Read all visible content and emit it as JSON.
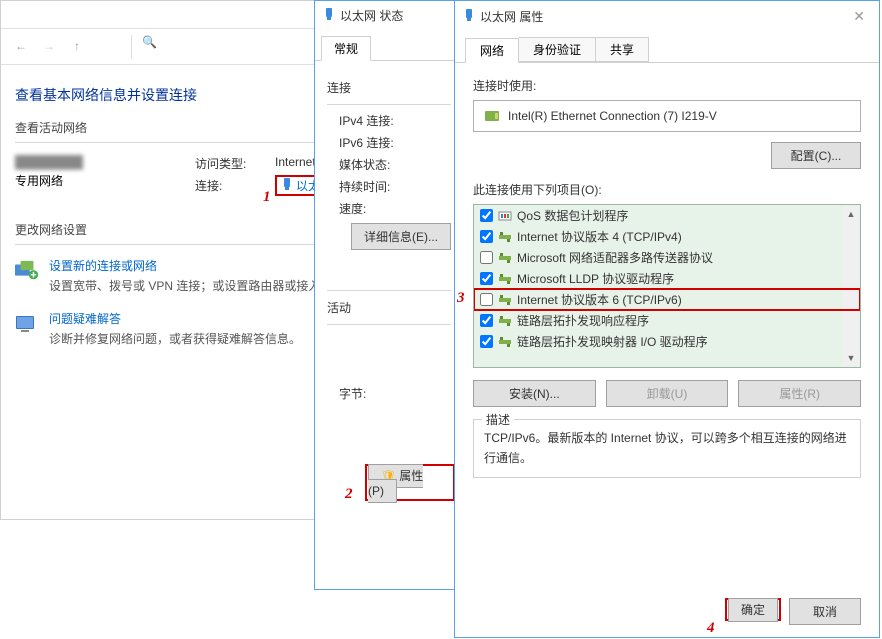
{
  "annotations": {
    "n1": "1",
    "n2": "2",
    "n3": "3",
    "n4": "4"
  },
  "bg": {
    "heading": "查看基本网络信息并设置连接",
    "section_active": "查看活动网络",
    "access_type_label": "访问类型:",
    "access_type_value": "Internet",
    "conn_label": "连接:",
    "conn_value": "以太网",
    "private_net": "专用网络",
    "section_change": "更改网络设置",
    "link_new": "设置新的连接或网络",
    "link_new_desc": "设置宽带、拨号或 VPN 连接；或设置路由器或接入点。",
    "link_trouble": "问题疑难解答",
    "link_trouble_desc": "诊断并修复网络问题，或者获得疑难解答信息。"
  },
  "status": {
    "title": "以太网 状态",
    "tab_general": "常规",
    "section_conn": "连接",
    "ipv4_label": "IPv4 连接:",
    "ipv6_label": "IPv6 连接:",
    "media_label": "媒体状态:",
    "duration_label": "持续时间:",
    "speed_label": "速度:",
    "btn_details": "详细信息(E)...",
    "section_activity": "活动",
    "bytes_label": "字节:",
    "btn_props": "属性(P)"
  },
  "props": {
    "title": "以太网 属性",
    "tab_net": "网络",
    "tab_auth": "身份验证",
    "tab_share": "共享",
    "connect_using": "连接时使用:",
    "adapter_name": "Intel(R) Ethernet Connection (7) I219-V",
    "btn_config": "配置(C)...",
    "uses_items": "此连接使用下列项目(O):",
    "items": [
      {
        "label": "QoS 数据包计划程序",
        "checked": true,
        "icon": "qos"
      },
      {
        "label": "Internet 协议版本 4 (TCP/IPv4)",
        "checked": true,
        "icon": "proto"
      },
      {
        "label": "Microsoft 网络适配器多路传送器协议",
        "checked": false,
        "icon": "proto"
      },
      {
        "label": "Microsoft LLDP 协议驱动程序",
        "checked": true,
        "icon": "proto"
      },
      {
        "label": "Internet 协议版本 6 (TCP/IPv6)",
        "checked": false,
        "icon": "proto",
        "highlight": true
      },
      {
        "label": "链路层拓扑发现响应程序",
        "checked": true,
        "icon": "proto"
      },
      {
        "label": "链路层拓扑发现映射器 I/O 驱动程序",
        "checked": true,
        "icon": "proto"
      }
    ],
    "btn_install": "安装(N)...",
    "btn_uninstall": "卸载(U)",
    "btn_item_props": "属性(R)",
    "desc_legend": "描述",
    "desc_text": "TCP/IPv6。最新版本的 Internet 协议，可以跨多个相互连接的网络进行通信。",
    "btn_ok": "确定",
    "btn_cancel": "取消"
  }
}
